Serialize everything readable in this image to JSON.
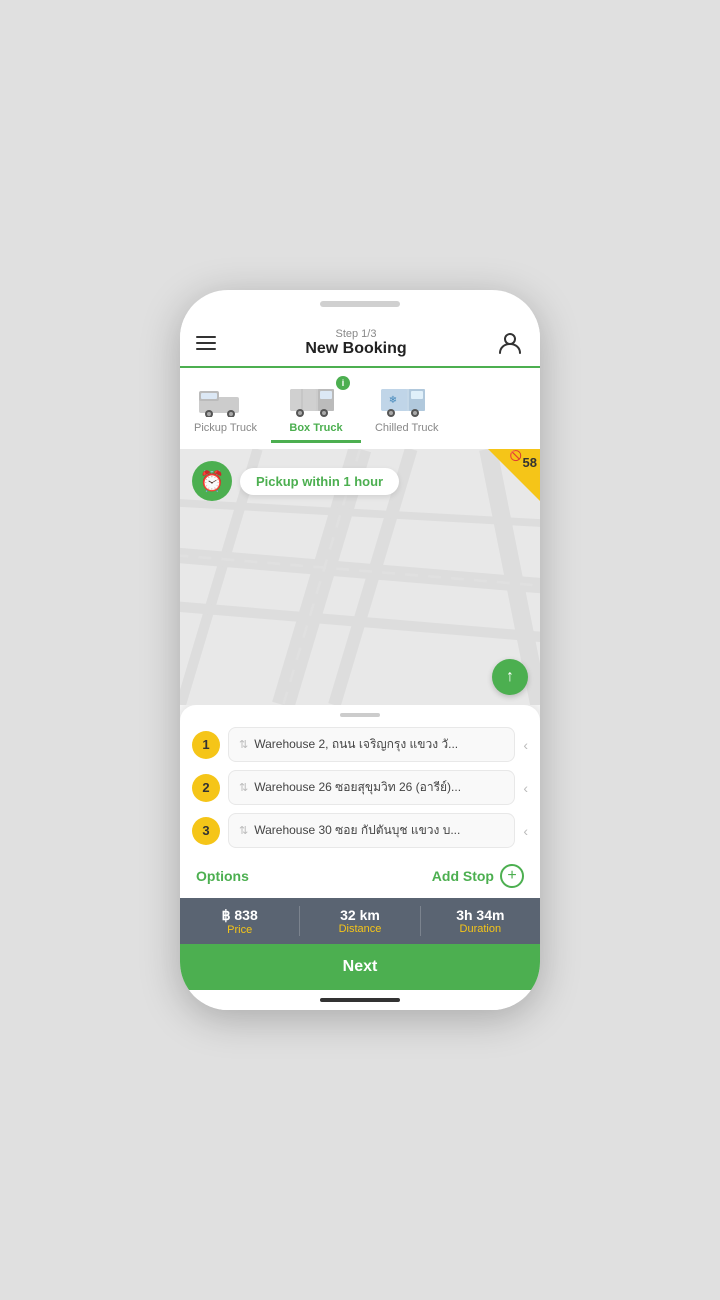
{
  "header": {
    "step_label": "Step 1/3",
    "title": "New Booking"
  },
  "trucks": [
    {
      "id": "pickup",
      "label": "Pickup Truck",
      "active": false
    },
    {
      "id": "box",
      "label": "Box Truck",
      "active": true
    },
    {
      "id": "chilled",
      "label": "Chilled Truck",
      "active": false
    },
    {
      "id": "other",
      "label": "...",
      "active": false
    }
  ],
  "pickup_pill": {
    "text": "Pickup within 1 hour"
  },
  "corner_badge": {
    "count": "58"
  },
  "stops": [
    {
      "number": "1",
      "address": "Warehouse 2, ถนน เจริญกรุง แขวง วั..."
    },
    {
      "number": "2",
      "address": "Warehouse 26 ซอยสุขุมวิท 26 (อารีย์)..."
    },
    {
      "number": "3",
      "address": "Warehouse 30 ซอย กัปตันบุช แขวง บ..."
    }
  ],
  "options_btn": "Options",
  "add_stop_label": "Add Stop",
  "stats": {
    "price_value": "฿ 838",
    "price_label": "Price",
    "distance_value": "32 km",
    "distance_label": "Distance",
    "duration_value": "3h 34m",
    "duration_label": "Duration"
  },
  "next_btn": "Next"
}
